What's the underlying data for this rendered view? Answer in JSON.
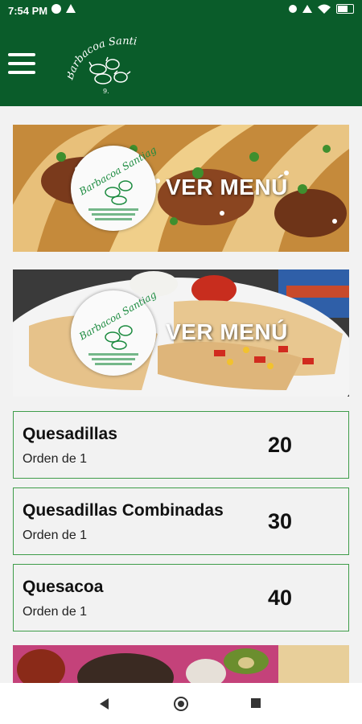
{
  "status_bar": {
    "time": "7:54 PM"
  },
  "header": {
    "menu_icon": "hamburger-menu-icon",
    "logo_text": "Barbacoa Santiago",
    "brand_color": "#0a5c2a"
  },
  "banners": [
    {
      "label": "VER MENÚ",
      "image": "tacos-photo"
    },
    {
      "label": "VER MENÚ",
      "image": "quesadillas-photo"
    },
    {
      "label": "",
      "image": "dishes-photo"
    }
  ],
  "menu_items": [
    {
      "name": "Quesadillas",
      "subtitle": "Orden de 1",
      "price": "20"
    },
    {
      "name": "Quesadillas Combinadas",
      "subtitle": "Orden de 1",
      "price": "30"
    },
    {
      "name": "Quesacoa",
      "subtitle": "Orden de 1",
      "price": "40"
    }
  ],
  "accent_color": "#3f9d4a"
}
